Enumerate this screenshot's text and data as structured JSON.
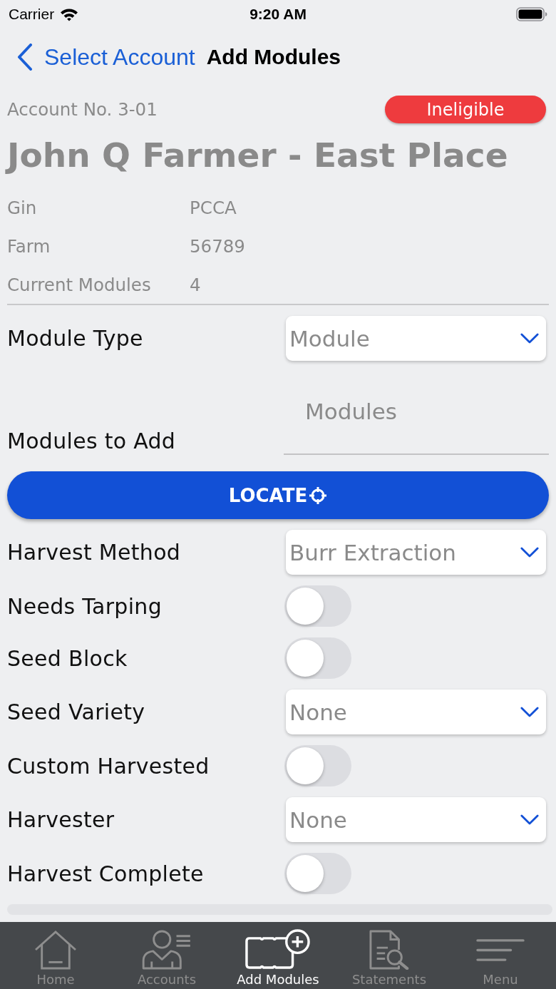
{
  "status_bar": {
    "carrier": "Carrier",
    "time": "9:20 AM"
  },
  "nav": {
    "back_label": "Select Account",
    "title": "Add Modules"
  },
  "account": {
    "number": "Account No. 3-01",
    "status": "Ineligible",
    "name": "John Q Farmer - East Place",
    "details": [
      {
        "label": "Gin",
        "value": "PCCA"
      },
      {
        "label": "Farm",
        "value": "56789"
      },
      {
        "label": "Current Modules",
        "value": "4"
      }
    ]
  },
  "form": {
    "rows": [
      {
        "kind": "dropdown",
        "label": "Module Type",
        "value": "Module"
      },
      {
        "kind": "text",
        "label": "Modules to Add",
        "placeholder": "Modules"
      },
      {
        "kind": "button",
        "label": "LOCATE"
      },
      {
        "kind": "dropdown",
        "label": "Harvest Method",
        "value": "Burr Extraction"
      },
      {
        "kind": "toggle",
        "label": "Needs Tarping",
        "on": false
      },
      {
        "kind": "toggle",
        "label": "Seed Block",
        "on": false
      },
      {
        "kind": "dropdown",
        "label": "Seed Variety",
        "value": "None"
      },
      {
        "kind": "toggle",
        "label": "Custom Harvested",
        "on": false
      },
      {
        "kind": "dropdown",
        "label": "Harvester",
        "value": "None"
      },
      {
        "kind": "toggle",
        "label": "Harvest Complete",
        "on": false
      }
    ]
  },
  "tab_bar": [
    {
      "label": "Home",
      "selected": false
    },
    {
      "label": "Accounts",
      "selected": false
    },
    {
      "label": "Add Modules",
      "selected": true
    },
    {
      "label": "Statements",
      "selected": false
    },
    {
      "label": "Menu",
      "selected": false
    }
  ]
}
